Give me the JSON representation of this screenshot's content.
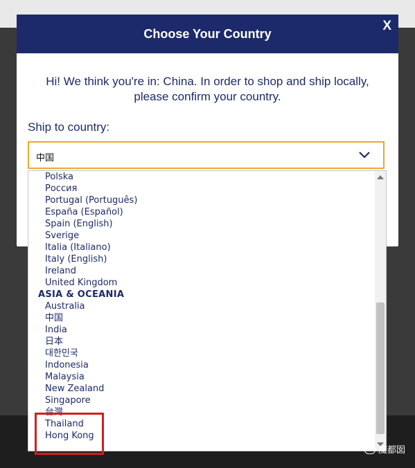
{
  "modal": {
    "title": "Choose Your Country",
    "close_label": "X",
    "message": "Hi! We think you're in: China. In order to shop and ship locally, please confirm your country.",
    "ship_label": "Ship to country:",
    "selected_country": "中国"
  },
  "country_list": [
    {
      "label": "Polska",
      "type": "option"
    },
    {
      "label": "Россия",
      "type": "option"
    },
    {
      "label": "Portugal (Português)",
      "type": "option"
    },
    {
      "label": "España (Español)",
      "type": "option"
    },
    {
      "label": "Spain (English)",
      "type": "option"
    },
    {
      "label": "Sverige",
      "type": "option"
    },
    {
      "label": "Italia (Italiano)",
      "type": "option"
    },
    {
      "label": "Italy (English)",
      "type": "option"
    },
    {
      "label": "Ireland",
      "type": "option"
    },
    {
      "label": "United Kingdom",
      "type": "option"
    },
    {
      "label": "ASIA & OCEANIA",
      "type": "group"
    },
    {
      "label": "Australia",
      "type": "option"
    },
    {
      "label": "中国",
      "type": "option"
    },
    {
      "label": "India",
      "type": "option"
    },
    {
      "label": "日本",
      "type": "option"
    },
    {
      "label": "대한민국",
      "type": "option"
    },
    {
      "label": "Indonesia",
      "type": "option"
    },
    {
      "label": "Malaysia",
      "type": "option"
    },
    {
      "label": "New Zealand",
      "type": "option"
    },
    {
      "label": "Singapore",
      "type": "option"
    },
    {
      "label": "台灣",
      "type": "option"
    },
    {
      "label": "Thailand",
      "type": "option"
    },
    {
      "label": "Hong Kong",
      "type": "option"
    }
  ],
  "watermark": {
    "text": "魔都囡"
  },
  "colors": {
    "header": "#1c2a6b",
    "accent": "#f0a533",
    "highlight": "#d21f1f"
  }
}
